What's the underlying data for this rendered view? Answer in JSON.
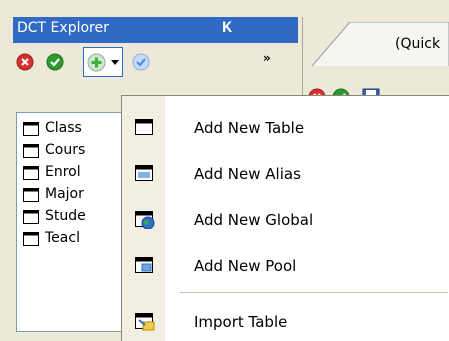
{
  "panel": {
    "title": "DCT Explorer",
    "pin_icon": "pin-icon",
    "more_glyph": "»"
  },
  "tree": {
    "items": [
      {
        "label": "Class"
      },
      {
        "label": "Cours"
      },
      {
        "label": "Enrol"
      },
      {
        "label": "Major"
      },
      {
        "label": "Stude"
      },
      {
        "label": "Teacl"
      }
    ]
  },
  "right_window": {
    "tab_label": "(Quick"
  },
  "menu": {
    "items": [
      {
        "label": "Add New Table",
        "icon": "table-icon"
      },
      {
        "label": "Add New Alias",
        "icon": "alias-icon"
      },
      {
        "label": "Add New Global",
        "icon": "global-icon"
      },
      {
        "label": "Add New Pool",
        "icon": "pool-icon"
      },
      {
        "label": "Import Table",
        "icon": "import-table-icon"
      }
    ]
  },
  "colors": {
    "title_bar": "#316ac5",
    "cancel_red": "#d9302f",
    "ok_green": "#2e9a2e",
    "add_green": "#3fae3f",
    "check_blue": "#4f8fe0"
  }
}
